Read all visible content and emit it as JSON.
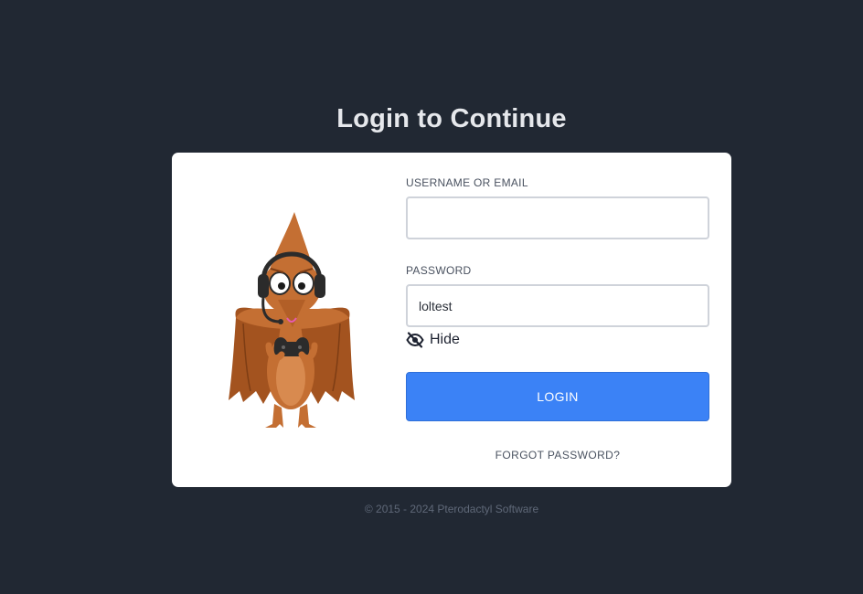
{
  "page": {
    "title": "Login to Continue",
    "footer": "© 2015 - 2024 Pterodactyl Software"
  },
  "form": {
    "username_label": "USERNAME OR EMAIL",
    "username_value": "",
    "password_label": "PASSWORD",
    "password_value": "loltest",
    "toggle_label": "Hide",
    "toggle_icon": "eye-slash-icon",
    "login_label": "LOGIN",
    "forgot_label": "FORGOT PASSWORD?"
  },
  "colors": {
    "background": "#212833",
    "card": "#ffffff",
    "primary": "#3b82f6",
    "mascot": "#c46f33"
  }
}
